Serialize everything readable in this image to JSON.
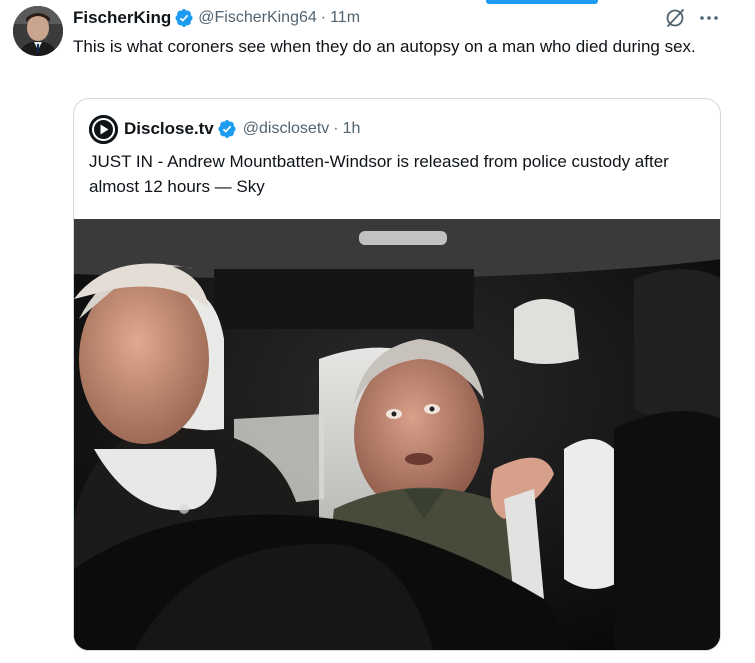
{
  "tweet": {
    "display_name": "FischerKing",
    "handle": "@FischerKing64",
    "separator": "·",
    "time": "11m",
    "text": "This is what coroners see when they do an autopsy on a man who died during sex."
  },
  "quote": {
    "display_name": "Disclose.tv",
    "handle": "@disclosetv",
    "separator": "·",
    "time": "1h",
    "text": "JUST IN - Andrew Mountbatten-Windsor is released from police custody after almost 12 hours — Sky"
  },
  "colors": {
    "accent": "#1d9bf0",
    "secondary_text": "#536471",
    "border": "#cfd9de"
  },
  "icons": {
    "verified": "verified-badge-icon",
    "grok": "grok-icon",
    "more": "more-options-icon",
    "quote_logo": "disclose-play-logo-icon"
  }
}
